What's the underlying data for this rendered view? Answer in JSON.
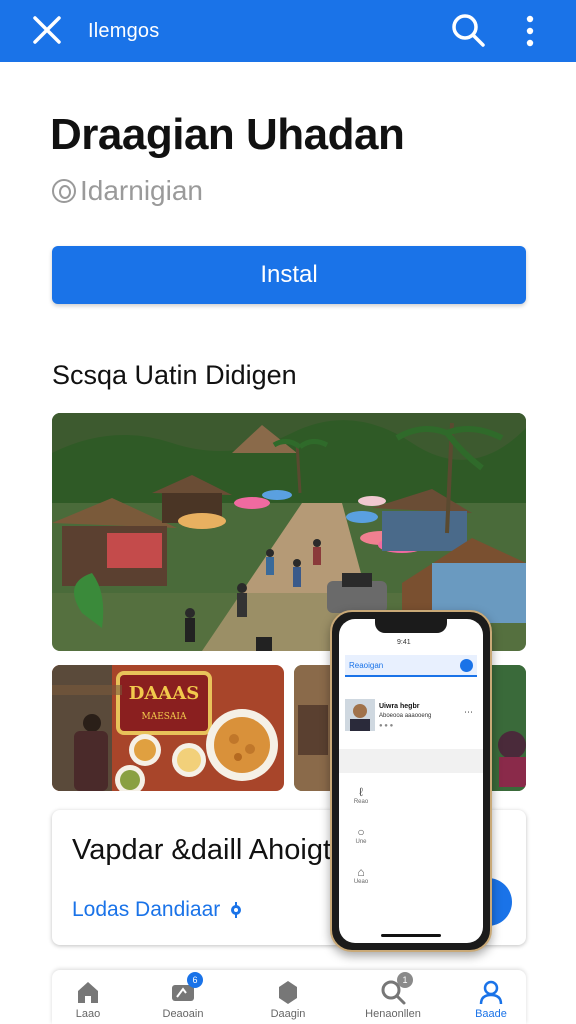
{
  "appbar": {
    "title": "Ilemgos",
    "close_icon": "close-icon",
    "search_icon": "search-icon",
    "more_icon": "more-vertical-icon",
    "color": "#1a73e8"
  },
  "app": {
    "name": "Draagian Uhadan",
    "developer": "Idarnigian",
    "install_label": "Instal"
  },
  "screenshots": {
    "section_title": "Scsqa Uatin Didigen",
    "food_sign": "DAAAS",
    "food_sign_sub": "MAESAIA"
  },
  "phone": {
    "time": "9:41",
    "search_text": "Reaoigan",
    "user_name": "Uiwra hegbr",
    "user_sub": "Aboeooa aaaooeng",
    "user_meta": "● ● ●",
    "items": [
      {
        "label": "Reao",
        "glyph": "ℓ"
      },
      {
        "label": "Une",
        "glyph": "○"
      },
      {
        "label": "Ueao",
        "glyph": "⌂"
      }
    ]
  },
  "card": {
    "title": "Vapdar &daill Ahoigt",
    "link": "Lodas Dandiaar"
  },
  "bottom_nav": [
    {
      "label": "Laao",
      "icon": "home-icon"
    },
    {
      "label": "Deaoain",
      "icon": "games-icon",
      "badge": "6"
    },
    {
      "label": "Daagin",
      "icon": "tag-icon"
    },
    {
      "label": "Henaonllen",
      "icon": "search-icon",
      "badge": "1"
    },
    {
      "label": "Baade",
      "icon": "account-icon",
      "active": true
    }
  ]
}
